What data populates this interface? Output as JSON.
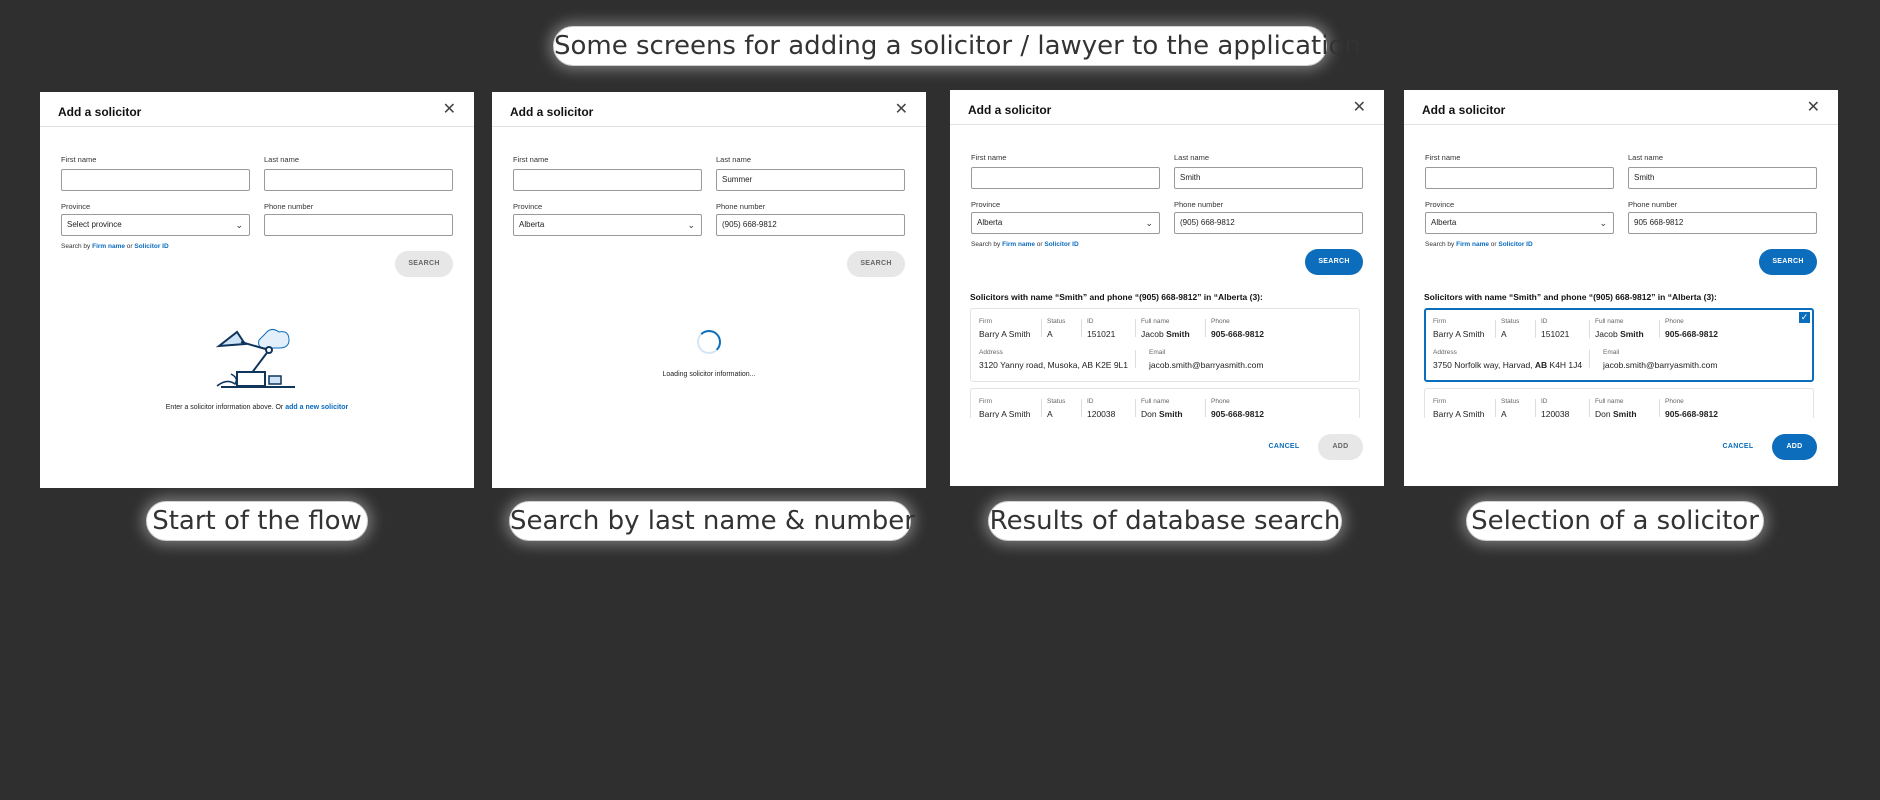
{
  "header": {
    "title": "Some screens for adding a solicitor / lawyer to the application"
  },
  "dialog": {
    "title": "Add a solicitor",
    "close_glyph": "✕",
    "labels": {
      "first_name": "First name",
      "last_name": "Last name",
      "province": "Province",
      "phone": "Phone number"
    },
    "search_by": {
      "prefix": "Search by",
      "firm_name": "Firm name",
      "or": "or",
      "solicitor_id": "Solicitor ID"
    },
    "search_label": "SEARCH",
    "cancel_label": "CANCEL",
    "add_label": "ADD",
    "chevron_glyph": "⌄"
  },
  "screens": [
    {
      "caption": "Start of the flow",
      "first_name": "",
      "last_name": "",
      "province": "Select province",
      "phone": "",
      "empty_prefix": "Enter a solicitor information above. Or",
      "empty_link": "add a new solicitor"
    },
    {
      "caption": "Search by last name & number",
      "first_name": "",
      "last_name": "Summer",
      "province": "Alberta",
      "phone": "(905) 668-9812",
      "loading_text": "Loading solicitor information..."
    },
    {
      "caption": "Results of database search",
      "first_name": "",
      "last_name": "Smith",
      "province": "Alberta",
      "phone": "(905) 668-9812",
      "results_heading": "Solicitors with name “Smith” and phone “(905) 668-9812” in “Alberta (3):",
      "results": [
        {
          "firm": "Barry A Smith",
          "status": "A",
          "id": "151021",
          "full_first": "Jacob",
          "full_last": "Smith",
          "phone": "905-668-9812",
          "address": "3120 Yanny road, Musoka, AB K2E 9L1",
          "email": "jacob.smith@barryasmith.com"
        },
        {
          "firm": "Barry A Smith",
          "status": "A",
          "id": "120038",
          "full_first": "Don",
          "full_last": "Smith",
          "phone": "905-668-9812"
        }
      ]
    },
    {
      "caption": "Selection of a solicitor",
      "first_name": "",
      "last_name": "Smith",
      "province": "Alberta",
      "phone": "905 668-9812",
      "results_heading": "Solicitors with name “Smith” and phone “(905) 668-9812” in “Alberta (3):",
      "results": [
        {
          "firm": "Barry A Smith",
          "status": "A",
          "id": "151021",
          "full_first": "Jacob",
          "full_last": "Smith",
          "phone": "905-668-9812",
          "address_pre": "3750 Norfolk way, Harvad, ",
          "address_prov": "AB",
          "address_post": " K4H 1J4",
          "email": "jacob.smith@barryasmith.com"
        },
        {
          "firm": "Barry A Smith",
          "status": "A",
          "id": "120038",
          "full_first": "Don",
          "full_last": "Smith",
          "phone": "905-668-9812"
        }
      ]
    }
  ],
  "result_keys": {
    "firm": "Firm",
    "status": "Status",
    "id": "ID",
    "full_name": "Full name",
    "phone": "Phone",
    "address": "Address",
    "email": "Email"
  },
  "colors": {
    "background": "#2f2f2f",
    "accent": "#0b6dbc",
    "panel": "#ffffff"
  },
  "icons": {
    "close": "close-icon",
    "chevron": "chevron-down-icon",
    "illustration": "desk-lamp-illustration",
    "check": "checkbox-checked-icon"
  }
}
